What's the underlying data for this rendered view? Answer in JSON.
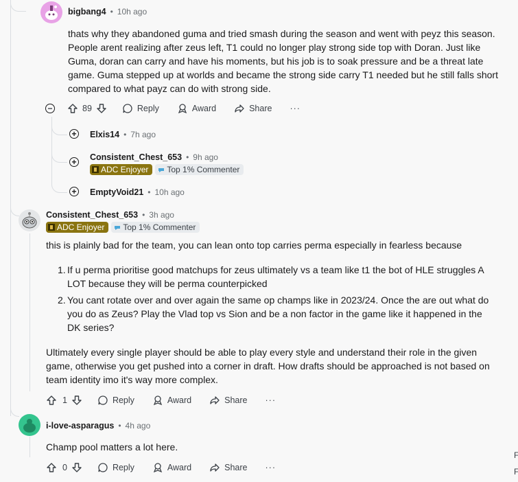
{
  "comment1": {
    "author": "bigbang4",
    "time": "10h ago",
    "body": "thats why they abandoned guma and tried smash during the season and went with peyz this season. People arent realizing after zeus left, T1 could no longer play strong side top with Doran. Just like Guma, doran can carry and have his moments, but his job is to soak pressure and be a threat late game. Guma stepped up at worlds and became the strong side carry T1 needed but he still falls short compared to what payz can do with strong side.",
    "votes": "89",
    "reply_label": "Reply",
    "award_label": "Award",
    "share_label": "Share",
    "more_label": "···"
  },
  "collapsed": [
    {
      "author": "Elxis14",
      "time": "7h ago",
      "expand": "+"
    },
    {
      "author": "Consistent_Chest_653",
      "time": "9h ago",
      "expand": "+",
      "flair": "ADC Enjoyer",
      "badge": "Top 1% Commenter"
    },
    {
      "author": "EmptyVoid21",
      "time": "10h ago",
      "expand": "+"
    }
  ],
  "collapse_symbol": "−",
  "comment2": {
    "author": "Consistent_Chest_653",
    "time": "3h ago",
    "flair": "ADC Enjoyer",
    "badge": "Top 1% Commenter",
    "intro": "this is plainly bad for the team, you can lean onto top carries perma especially in fearless because",
    "list": [
      {
        "num": "1.",
        "text": "If u perma prioritise good matchups for zeus ultimately vs a team like t1 the bot of HLE struggles A LOT because they will be perma counterpicked"
      },
      {
        "num": "2.",
        "text": "You cant rotate over and over again the same op champs like in 2023/24. Once the are out what do you do as Zeus? Play the Vlad top vs Sion and be a non factor in the game like it happened in the DK series?"
      }
    ],
    "outro": "Ultimately every single player should be able to play every style and understand their role in the given game, otherwise you get pushed into a corner in draft. How drafts should be approached is not based on team identity imo it's way more complex.",
    "votes": "1",
    "reply_label": "Reply",
    "award_label": "Award",
    "share_label": "Share",
    "more_label": "···"
  },
  "comment3": {
    "author": "i-love-asparagus",
    "time": "4h ago",
    "body": "Champ pool matters a lot here.",
    "votes": "0",
    "reply_label": "Reply",
    "award_label": "Award",
    "share_label": "Share",
    "more_label": "···"
  },
  "right_edge_text": [
    "F",
    "F"
  ],
  "separator": "•",
  "colors": {
    "flair_bg": "#8a7410",
    "badge_bg": "#e8ebee",
    "avatar_pink": "#e8a2e6",
    "avatar_green": "#34c48e"
  }
}
